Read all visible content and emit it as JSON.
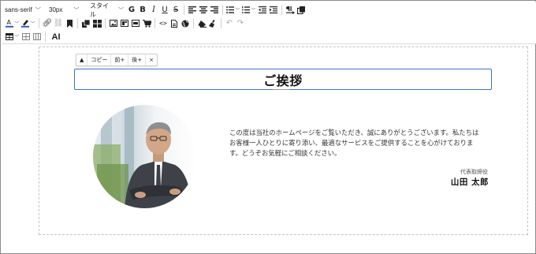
{
  "toolbar": {
    "font_family": "sans-serif",
    "font_size": "30px",
    "style_label": "スタイル",
    "ai_label": "AI"
  },
  "floating_toolbar": {
    "up": "▲",
    "copy": "コピー",
    "insert_before": "前+",
    "insert_after": "後+",
    "delete": "×"
  },
  "content": {
    "heading": "ご挨拶",
    "message": "この度は当社のホームページをご覧いただき、誠にありがとうございます。私たちはお客様一人ひとりに寄り添い、最適なサービスをご提供することを心がけております。どうぞお気軽にご相談ください。",
    "job_title": "代表取締役",
    "name": "山田 太郎"
  }
}
